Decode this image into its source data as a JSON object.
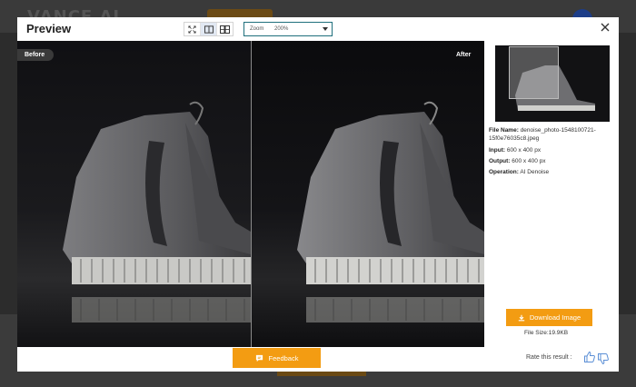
{
  "background": {
    "logo_text": "VANCE AI"
  },
  "modal": {
    "title": "Preview",
    "close_icon": "close-icon",
    "view_modes": [
      {
        "name": "fullscreen-icon",
        "active": false
      },
      {
        "name": "split-view-icon",
        "active": true
      },
      {
        "name": "side-by-side-icon",
        "active": false
      }
    ],
    "zoom": {
      "label": "Zoom",
      "value": "200%"
    }
  },
  "compare": {
    "before_label": "Before",
    "after_label": "After"
  },
  "info": {
    "file_name_label": "File Name:",
    "file_name_value": "denoise_photo-1548100721-15f0e76035c8.jpeg",
    "input_label": "Input:",
    "input_value": "600 x 400 px",
    "output_label": "Output:",
    "output_value": "600 x 400 px",
    "operation_label": "Operation:",
    "operation_value": "AI Denoise",
    "download_label": "Download Image",
    "file_size": "File Size:19.9KB"
  },
  "footer": {
    "feedback_label": "Feedback",
    "rate_label": "Rate this result :"
  },
  "colors": {
    "accent": "#f39c12",
    "zoom_border": "#1f6f7c"
  }
}
